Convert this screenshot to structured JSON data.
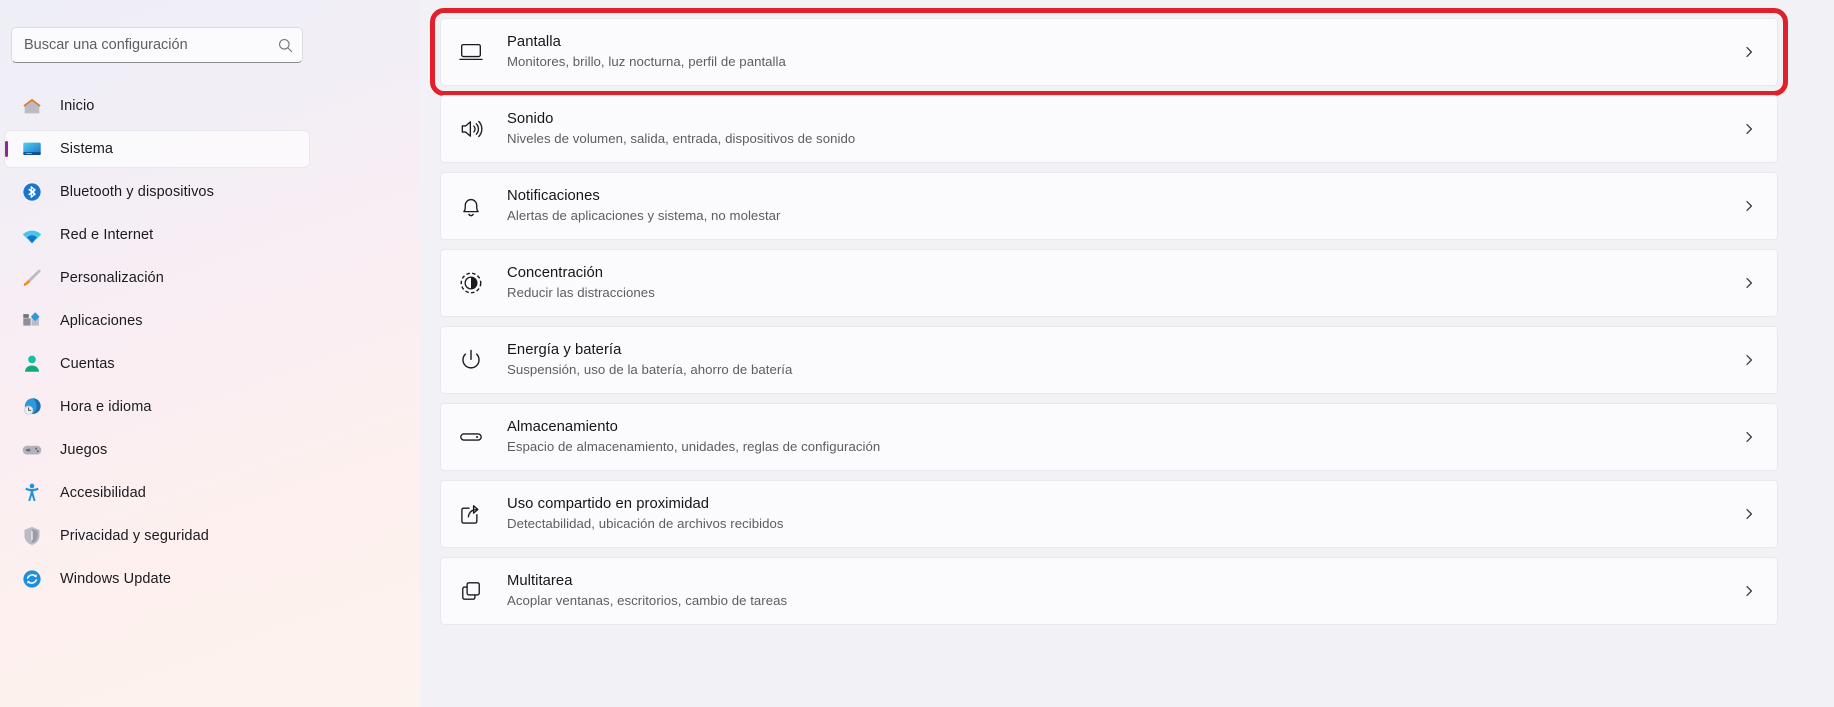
{
  "search": {
    "placeholder": "Buscar una configuración",
    "value": "",
    "icon": "search-icon"
  },
  "sidebar": {
    "items": [
      {
        "label": "Inicio",
        "icon": "home-icon",
        "selected": false
      },
      {
        "label": "Sistema",
        "icon": "system-icon",
        "selected": true
      },
      {
        "label": "Bluetooth y dispositivos",
        "icon": "bluetooth-icon",
        "selected": false
      },
      {
        "label": "Red e Internet",
        "icon": "wifi-icon",
        "selected": false
      },
      {
        "label": "Personalización",
        "icon": "paintbrush-icon",
        "selected": false
      },
      {
        "label": "Aplicaciones",
        "icon": "apps-icon",
        "selected": false
      },
      {
        "label": "Cuentas",
        "icon": "account-icon",
        "selected": false
      },
      {
        "label": "Hora e idioma",
        "icon": "clock-globe-icon",
        "selected": false
      },
      {
        "label": "Juegos",
        "icon": "gamepad-icon",
        "selected": false
      },
      {
        "label": "Accesibilidad",
        "icon": "accessibility-icon",
        "selected": false
      },
      {
        "label": "Privacidad y seguridad",
        "icon": "shield-icon",
        "selected": false
      },
      {
        "label": "Windows Update",
        "icon": "update-icon",
        "selected": false
      }
    ]
  },
  "main": {
    "cards": [
      {
        "title": "Pantalla",
        "subtitle": "Monitores, brillo, luz nocturna, perfil de pantalla",
        "icon": "monitor-icon",
        "chevron": "chevron-right-icon",
        "highlighted": true
      },
      {
        "title": "Sonido",
        "subtitle": "Niveles de volumen, salida, entrada, dispositivos de sonido",
        "icon": "speaker-icon",
        "chevron": "chevron-right-icon",
        "highlighted": false
      },
      {
        "title": "Notificaciones",
        "subtitle": "Alertas de aplicaciones y sistema, no molestar",
        "icon": "bell-icon",
        "chevron": "chevron-right-icon",
        "highlighted": false
      },
      {
        "title": "Concentración",
        "subtitle": "Reducir las distracciones",
        "icon": "focus-icon",
        "chevron": "chevron-right-icon",
        "highlighted": false
      },
      {
        "title": "Energía y batería",
        "subtitle": "Suspensión, uso de la batería, ahorro de batería",
        "icon": "power-icon",
        "chevron": "chevron-right-icon",
        "highlighted": false
      },
      {
        "title": "Almacenamiento",
        "subtitle": "Espacio de almacenamiento, unidades, reglas de configuración",
        "icon": "storage-icon",
        "chevron": "chevron-right-icon",
        "highlighted": false
      },
      {
        "title": "Uso compartido en proximidad",
        "subtitle": "Detectabilidad, ubicación de archivos recibidos",
        "icon": "share-icon",
        "chevron": "chevron-right-icon",
        "highlighted": false
      },
      {
        "title": "Multitarea",
        "subtitle": "Acoplar ventanas, escritorios, cambio de tareas",
        "icon": "multitask-icon",
        "chevron": "chevron-right-icon",
        "highlighted": false
      }
    ]
  },
  "colors": {
    "highlight_border": "#e0202a",
    "accent_selected": "#91278f",
    "card_background": "#fbfbfd",
    "page_background": "#f2f2f6"
  }
}
